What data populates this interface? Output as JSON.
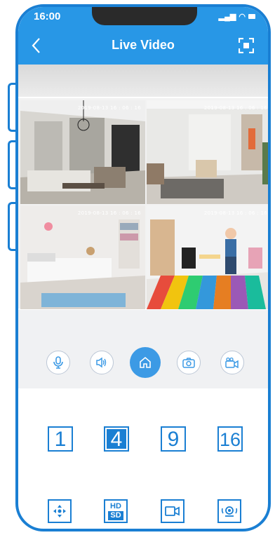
{
  "status_bar": {
    "time": "16:00",
    "signal": "▂▄▆",
    "wifi": "◠"
  },
  "header": {
    "title": "Live Video"
  },
  "cameras": [
    {
      "timestamp": "2019-08-13 16 : 06 : 16"
    },
    {
      "timestamp": "2019-08-13 16 : 06 : 16"
    },
    {
      "timestamp": "2019-08-13 16 : 06 : 16"
    },
    {
      "timestamp": "2019-08-13 16 : 06 : 16"
    }
  ],
  "layouts": [
    {
      "label": "1"
    },
    {
      "label": "4"
    },
    {
      "label": "9"
    },
    {
      "label": "16"
    }
  ],
  "hd_sd": {
    "hd": "HD",
    "sd": "SD"
  },
  "colors": {
    "brand": "#2897e6",
    "accent": "#1a7fd3"
  }
}
